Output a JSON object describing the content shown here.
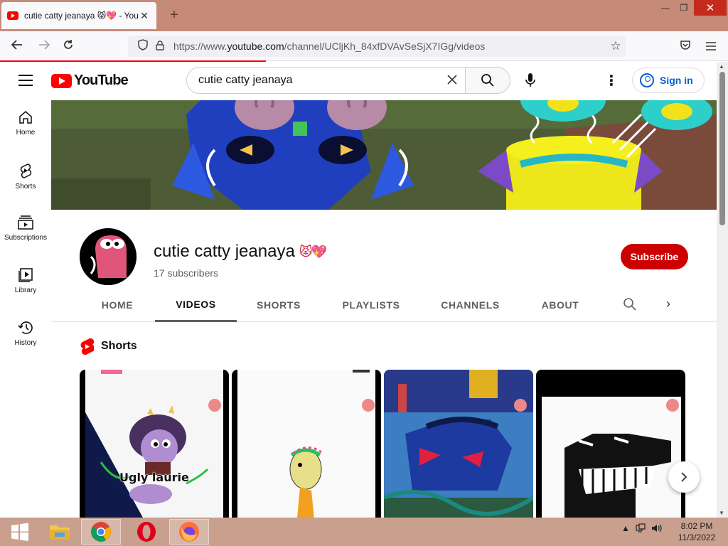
{
  "browser": {
    "tab_title": "cutie catty jeanaya 😾💖 - YouTube",
    "tab_close": "✕",
    "new_tab": "+",
    "url_prefix": "https://www.",
    "url_domain": "youtube.com",
    "url_path": "/channel/UCljKh_84xfDVAvSeSjX7IGg/videos",
    "window_min": "—",
    "window_max": "❐",
    "window_close": "✕"
  },
  "youtube": {
    "logo_text": "YouTube",
    "search_query": "cutie catty jeanaya",
    "sign_in": "Sign in",
    "guide": [
      {
        "label": "Home",
        "icon": "home-icon"
      },
      {
        "label": "Shorts",
        "icon": "shorts-icon"
      },
      {
        "label": "Subscriptions",
        "icon": "subscriptions-icon"
      },
      {
        "label": "Library",
        "icon": "library-icon"
      },
      {
        "label": "History",
        "icon": "history-icon"
      }
    ],
    "channel": {
      "name": "cutie catty jeanaya",
      "emoji": "😾💖",
      "subscribers": "17 subscribers",
      "subscribe_label": "Subscribe"
    },
    "tabs": [
      "HOME",
      "VIDEOS",
      "SHORTS",
      "PLAYLISTS",
      "CHANNELS",
      "ABOUT"
    ],
    "active_tab": "VIDEOS",
    "shorts_section_title": "Shorts",
    "shorts": [
      {
        "overlay_text": "Ugly laurie"
      },
      {
        "overlay_text": ""
      },
      {
        "overlay_text": ""
      },
      {
        "overlay_text": ""
      }
    ]
  },
  "taskbar": {
    "apps": [
      "start-icon",
      "file-explorer-icon",
      "chrome-icon",
      "opera-icon",
      "firefox-icon"
    ],
    "time": "8:02 PM",
    "date": "11/3/2022"
  },
  "colors": {
    "accent_red": "#ff0000",
    "subscribe_red": "#cc0000",
    "link_blue": "#065fd4",
    "tabstrip": "#c68a78",
    "taskbar": "#c9a08e"
  }
}
